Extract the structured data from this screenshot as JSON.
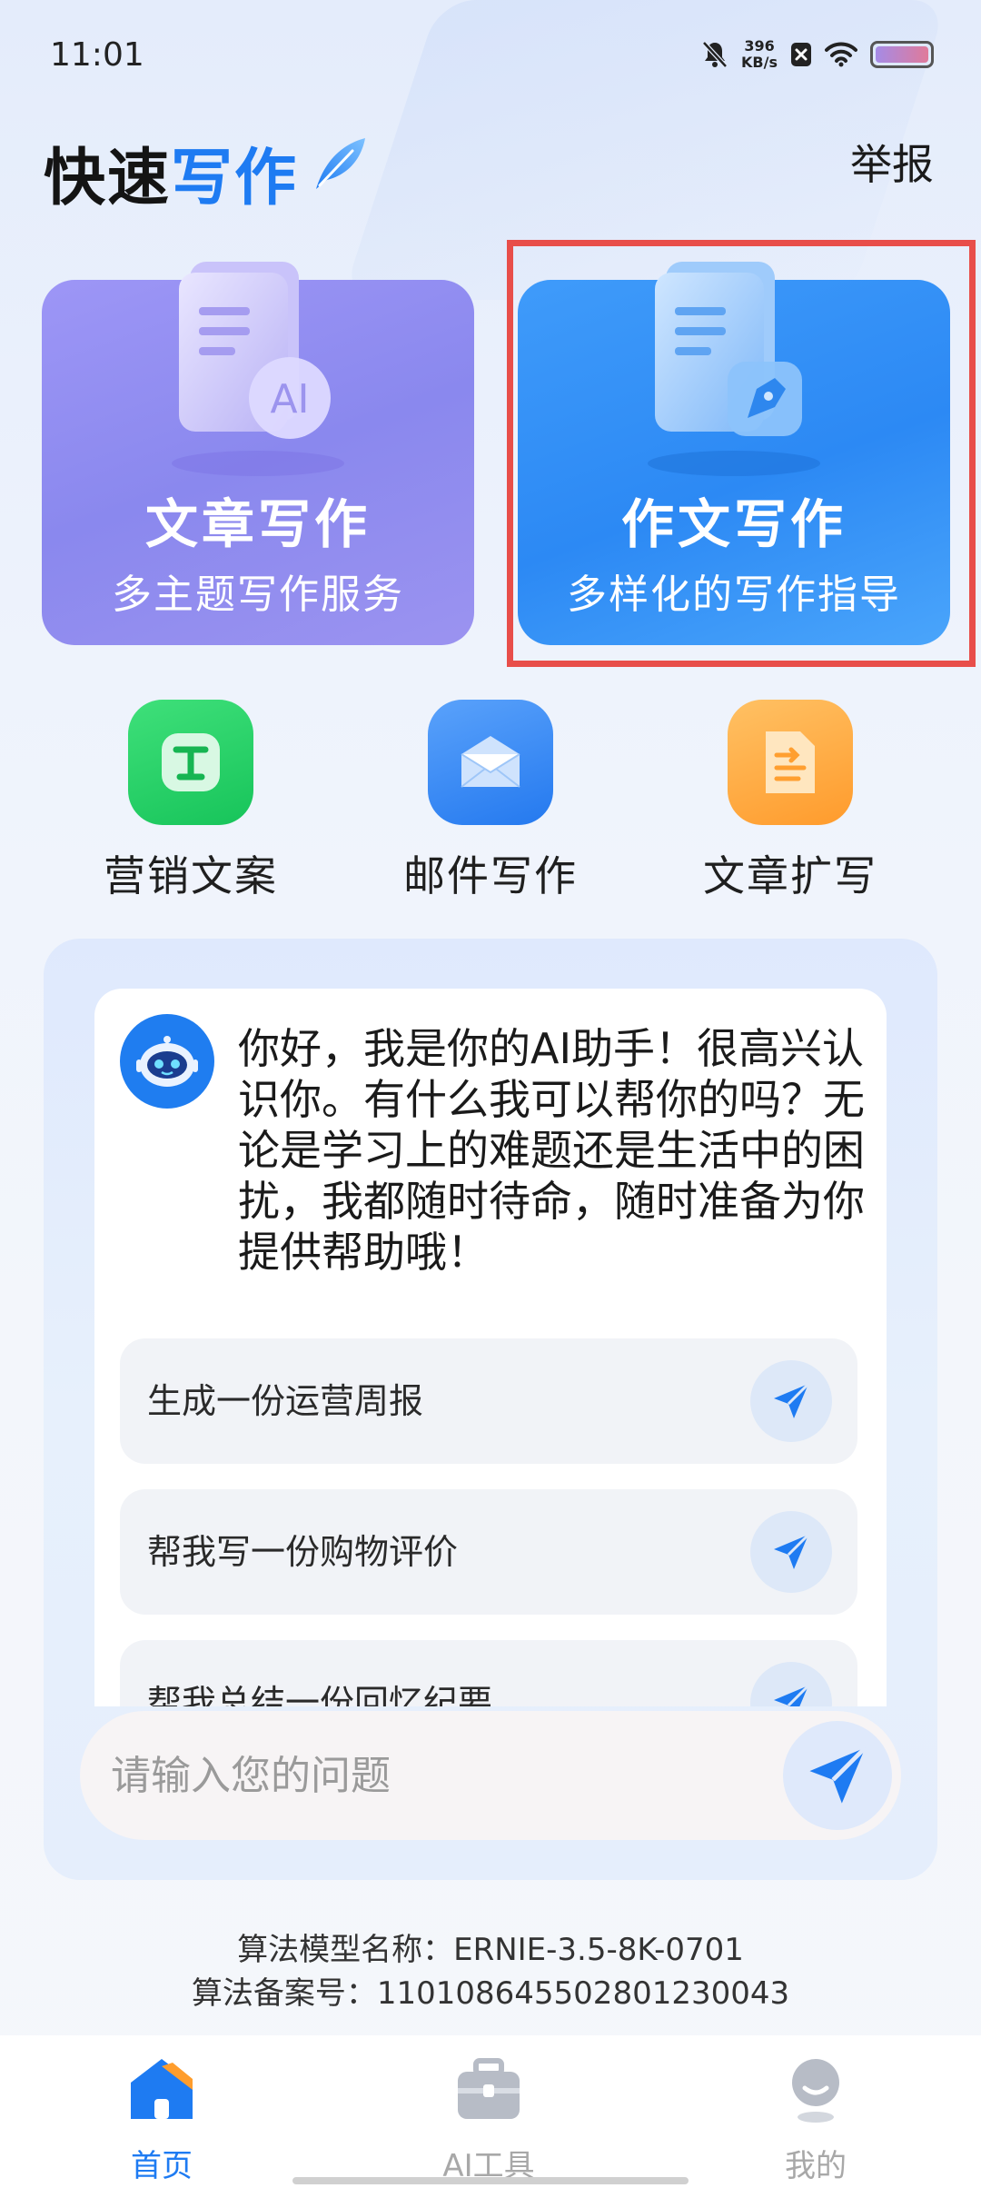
{
  "status_bar": {
    "time": "11:01",
    "net_speed_value": "396",
    "net_speed_unit": "KB/s"
  },
  "header": {
    "title_part1": "快速",
    "title_part2": "写作",
    "report_label": "举报"
  },
  "cards": {
    "article": {
      "title": "文章写作",
      "subtitle": "多主题写作服务",
      "badge": "AI"
    },
    "essay": {
      "title": "作文写作",
      "subtitle": "多样化的写作指导"
    }
  },
  "tools": {
    "marketing": "营销文案",
    "mail": "邮件写作",
    "expand": "文章扩写"
  },
  "chat": {
    "greeting": "你好，我是你的AI助手！很高兴认识你。有什么我可以帮你的吗？无论是学习上的难题还是生活中的困扰，我都随时待命，随时准备为你提供帮助哦！",
    "suggestions": [
      "生成一份运营周报",
      "帮我写一份购物评价",
      "帮我总结一份回忆纪要"
    ],
    "input_placeholder": "请输入您的问题"
  },
  "model_info": {
    "name": "算法模型名称：ERNIE-3.5-8K-0701",
    "filing": "算法备案号：110108645502801230043"
  },
  "nav": {
    "home": "首页",
    "tools": "AI工具",
    "me": "我的"
  },
  "colors": {
    "brand_blue": "#1e7bf2",
    "article_card": "#8a88ee",
    "essay_card": "#2c89f4",
    "highlight": "#e84e4a"
  }
}
